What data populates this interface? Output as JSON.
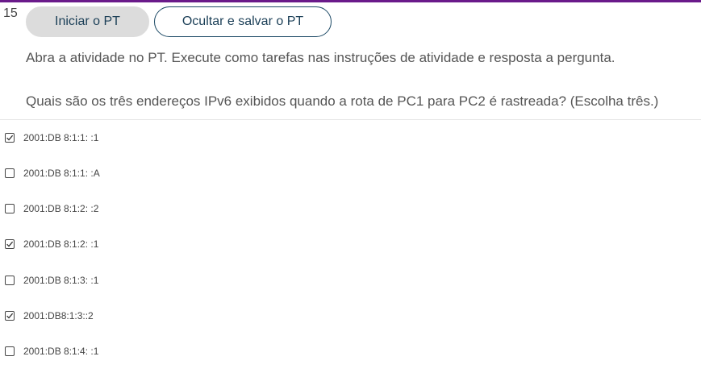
{
  "question": {
    "number": "15",
    "instruction": "Abra a atividade no PT. Execute como tarefas nas instruções de atividade e resposta a pergunta.",
    "text": "Quais são os três endereços IPv6 exibidos quando a rota de PC1 para PC2 é rastreada? (Escolha três.)"
  },
  "buttons": {
    "start_label": "Iniciar o PT",
    "hide_label": "Ocultar e salvar o PT"
  },
  "options": [
    {
      "label": "2001:DB 8:1:1: :1",
      "checked": true
    },
    {
      "label": "2001:DB 8:1:1: :A",
      "checked": false
    },
    {
      "label": "2001:DB 8:1:2: :2",
      "checked": false
    },
    {
      "label": "2001:DB 8:1:2: :1",
      "checked": true
    },
    {
      "label": "2001:DB 8:1:3: :1",
      "checked": false
    },
    {
      "label": "2001:DB8:1:3::2",
      "checked": true
    },
    {
      "label": "2001:DB 8:1:4: :1",
      "checked": false
    }
  ],
  "colors": {
    "accent": "#6a1a8a",
    "button_text": "#1b3f57",
    "button_border": "#1d4a66"
  }
}
